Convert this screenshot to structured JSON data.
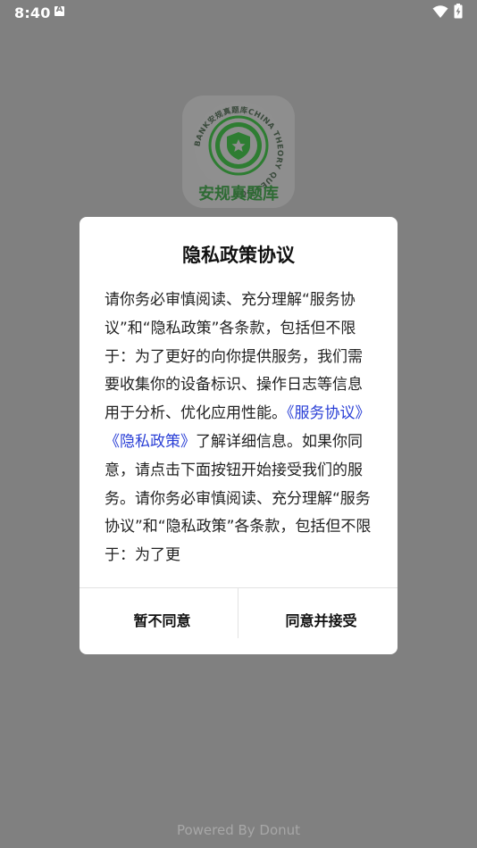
{
  "status_bar": {
    "time": "8:40",
    "notification_icon_letter": "A",
    "wifi_icon": "wifi-icon",
    "battery_icon": "battery-charging-icon"
  },
  "app_logo": {
    "name": "安规真题库",
    "ring_text": "BANK安规真题库CHINA THEORY QUESTION",
    "accent_color": "#2e7d32"
  },
  "dialog": {
    "title": "隐私政策协议",
    "body_part1": "请你务必审慎阅读、充分理解“服务协议”和“隐私政策”各条款，包括但不限于：为了更好的向你提供服务，我们需要收集你的设备标识、操作日志等信息用于分析、优化应用性能。",
    "link_service": "《服务协议》",
    "link_privacy": "《隐私政策》",
    "body_part2": "了解详细信息。如果你同意，请点击下面按钮开始接受我们的服务。请你务必审慎阅读、充分理解“服务协议”和“隐私政策”各条款，包括但不限于：为了更",
    "decline_label": "暂不同意",
    "accept_label": "同意并接受"
  },
  "footer": {
    "powered_by": "Powered By Donut"
  }
}
